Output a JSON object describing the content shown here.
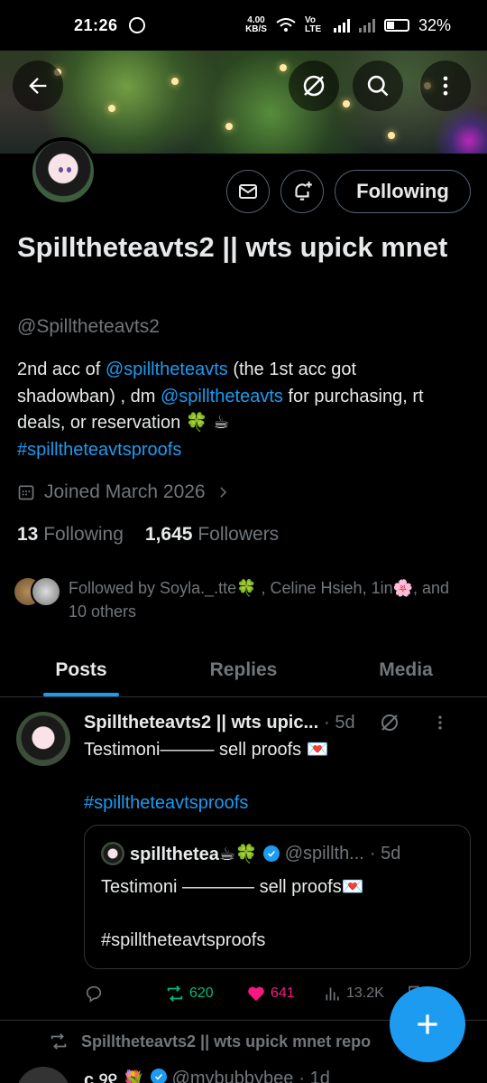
{
  "status_bar": {
    "time": "21:26",
    "network_speed_value": "4.00",
    "network_speed_unit": "KB/S",
    "network_type": "Vo LTE",
    "battery": "32%",
    "icons": [
      "whatsapp-icon",
      "wifi-icon",
      "signal-icon",
      "battery-icon"
    ]
  },
  "header": {
    "back_icon": "back-arrow-icon",
    "grok_icon": "grok-icon",
    "search_icon": "search-icon",
    "more_icon": "more-vertical-icon"
  },
  "profile": {
    "display_name": "Spilltheteavts2 || wts upick mnet",
    "handle": "@Spilltheteavts2",
    "bio": {
      "part1": "2nd acc of ",
      "mention1": "@spilltheteavts",
      "part2": " (the 1st acc got shadowban) , dm ",
      "mention2": "@spilltheteavts",
      "part3": " for purchasing, rt deals, or reservation 🍀 ☕",
      "hashtag": "#spilltheteavtsproofs"
    },
    "joined": "Joined March 2026",
    "following_count": "13",
    "following_label": "Following",
    "followers_count": "1,645",
    "followers_label": "Followers",
    "followed_by": "Followed by Soyla._.tte🍀 , Celine Hsieh, 1in🌸, and 10 others",
    "follow_button_label": "Following"
  },
  "tabs": [
    {
      "label": "Posts",
      "active": true
    },
    {
      "label": "Replies",
      "active": false
    },
    {
      "label": "Media",
      "active": false
    }
  ],
  "post": {
    "name": "Spilltheteavts2 || wts upic...",
    "time": "· 5d",
    "text_line": "Testimoni——— sell proofs 💌",
    "hashtag": "#spilltheteavtsproofs",
    "quote": {
      "name": "spillthetea☕🍀",
      "handle": "@spillth...",
      "time": "· 5d",
      "text_line": "Testimoni ———— sell proofs💌",
      "hashtag": "#spilltheteavtsproofs"
    },
    "reposts": "620",
    "likes": "641",
    "views": "13.2K"
  },
  "next_item": {
    "repost_label": "Spilltheteavts2 || wts upick mnet repo",
    "name": "c ୨୧ 💐",
    "handle": "@mybubbybee",
    "time": "· 1d"
  },
  "colors": {
    "accent": "#1d9bf0",
    "repost": "#00ba7c",
    "like": "#f91880",
    "muted": "#71767b"
  }
}
